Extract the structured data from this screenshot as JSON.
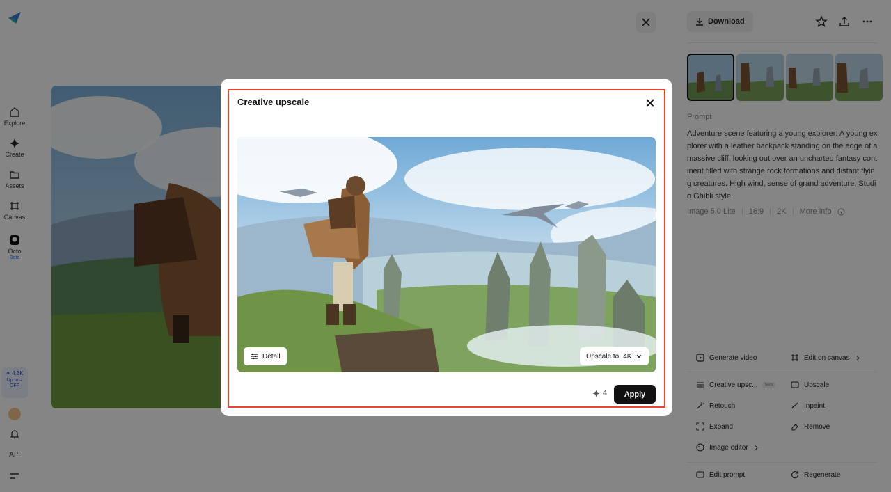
{
  "sidebar": {
    "items": [
      {
        "label": "Explore",
        "icon": "home-icon"
      },
      {
        "label": "Create",
        "icon": "sparkle-icon"
      },
      {
        "label": "Assets",
        "icon": "folder-icon"
      },
      {
        "label": "Canvas",
        "icon": "canvas-icon"
      },
      {
        "label": "Octo",
        "icon": "octo-icon",
        "badge": "Beta"
      }
    ],
    "credits": {
      "amount": "✦ 4.3K",
      "promo": "Up to – OFF"
    },
    "api_label": "API"
  },
  "right_panel": {
    "download_label": "Download",
    "prompt_heading": "Prompt",
    "prompt_text": "Adventure scene featuring a young explorer: A young explorer with a leather backpack standing on the edge of a massive cliff, looking out over an uncharted fantasy continent filled with strange rock formations and distant flying creatures. High wind, sense of grand adventure, Studio Ghibli style.",
    "meta": {
      "model": "Image 5.0 Lite",
      "ratio": "16:9",
      "resolution": "2K",
      "more_info": "More info"
    },
    "actions": {
      "generate_video": "Generate video",
      "edit_on_canvas": "Edit on canvas",
      "creative_upscale": "Creative upsc...",
      "creative_upscale_tag": "New",
      "upscale": "Upscale",
      "retouch": "Retouch",
      "inpaint": "Inpaint",
      "expand": "Expand",
      "remove": "Remove",
      "image_editor": "Image editor",
      "edit_prompt": "Edit prompt",
      "regenerate": "Regenerate"
    }
  },
  "modal": {
    "title": "Creative upscale",
    "detail_label": "Detail",
    "upscale_to_label": "Upscale to",
    "upscale_value": "4K",
    "credit_cost": "4",
    "apply_label": "Apply"
  },
  "colors": {
    "highlight": "#e8442f",
    "apply_bg": "#111111",
    "accent": "#2a6cff"
  }
}
